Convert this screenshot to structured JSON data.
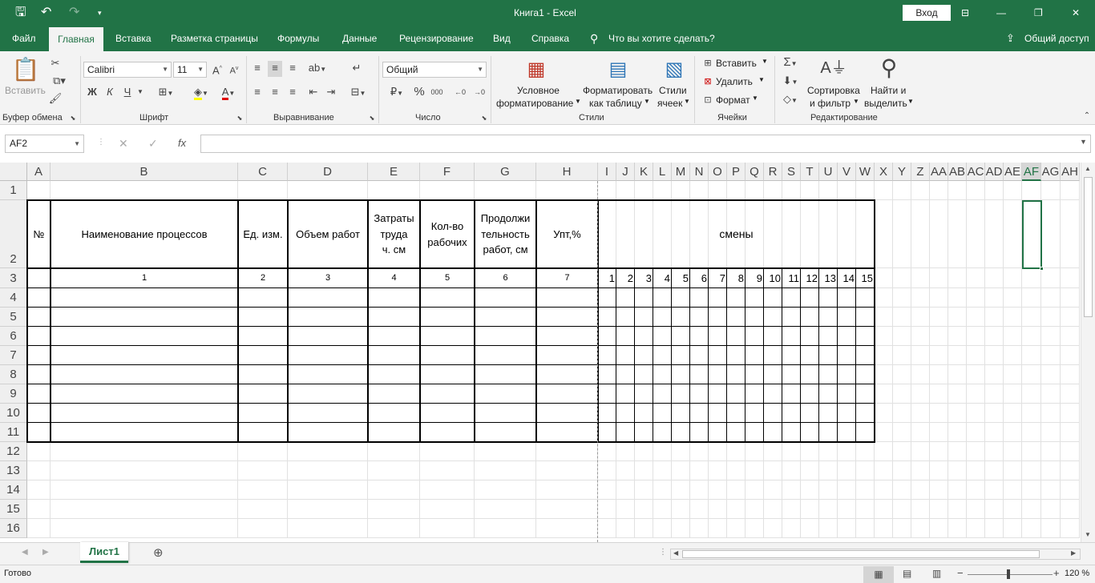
{
  "titlebar": {
    "save_icon": "save-icon",
    "undo_icon": "undo-icon",
    "redo_icon": "redo-icon",
    "title": "Книга1  -  Excel",
    "signin": "Вход",
    "minimize": "—",
    "restore": "❐",
    "close": "✕"
  },
  "tabs": [
    {
      "id": "file",
      "label": "Файл"
    },
    {
      "id": "home",
      "label": "Главная"
    },
    {
      "id": "insert",
      "label": "Вставка"
    },
    {
      "id": "layout",
      "label": "Разметка страницы"
    },
    {
      "id": "formulas",
      "label": "Формулы"
    },
    {
      "id": "data",
      "label": "Данные"
    },
    {
      "id": "review",
      "label": "Рецензирование"
    },
    {
      "id": "view",
      "label": "Вид"
    },
    {
      "id": "help",
      "label": "Справка"
    }
  ],
  "tellme": "Что вы хотите сделать?",
  "share": "Общий доступ",
  "ribbon": {
    "paste": "Вставить",
    "font_name": "Calibri",
    "font_size": "11",
    "bold": "Ж",
    "italic": "К",
    "underline": "Ч",
    "number_format": "Общий",
    "cond_format": [
      "Условное",
      "форматирование"
    ],
    "format_table": [
      "Форматировать",
      "как таблицу"
    ],
    "cell_styles": [
      "Стили",
      "ячеек"
    ],
    "cells_insert": "Вставить",
    "cells_delete": "Удалить",
    "cells_format": "Формат",
    "sort_filter": [
      "Сортировка",
      "и фильтр"
    ],
    "find_select": [
      "Найти и",
      "выделить"
    ],
    "groups": {
      "clipboard": "Буфер обмена",
      "font": "Шрифт",
      "alignment": "Выравнивание",
      "number": "Число",
      "styles": "Стили",
      "cells": "Ячейки",
      "editing": "Редактирование"
    }
  },
  "namebox": "AF2",
  "formula_fx": "fx",
  "columns": [
    "A",
    "B",
    "C",
    "D",
    "E",
    "F",
    "G",
    "H",
    "I",
    "J",
    "K",
    "L",
    "M",
    "N",
    "O",
    "P",
    "Q",
    "R",
    "S",
    "T",
    "U",
    "V",
    "W",
    "X",
    "Y",
    "Z",
    "AA",
    "AB",
    "AC",
    "AD",
    "AE",
    "AF",
    "AG",
    "AH"
  ],
  "selected_column": "AF",
  "rows": [
    "1",
    "2",
    "3",
    "4",
    "5",
    "6",
    "7",
    "8",
    "9",
    "10",
    "11",
    "12",
    "13",
    "14",
    "15",
    "16"
  ],
  "table": {
    "headers": [
      "№",
      "Наименование процессов",
      "Ед. изм.",
      "Объем работ",
      "Затраты\nтруда\nч. см",
      "Кол-во\nрабочих",
      "Продолжи\nтельность\nработ, см",
      "Упт,%",
      "смены"
    ],
    "numbers": [
      "1",
      "2",
      "3",
      "4",
      "5",
      "6",
      "7"
    ],
    "shifts": [
      "1",
      "2",
      "3",
      "4",
      "5",
      "6",
      "7",
      "8",
      "9",
      "10",
      "11",
      "12",
      "13",
      "14",
      "15"
    ]
  },
  "sheet_tab": "Лист1",
  "status": {
    "ready": "Готово",
    "zoom": "120 %"
  }
}
